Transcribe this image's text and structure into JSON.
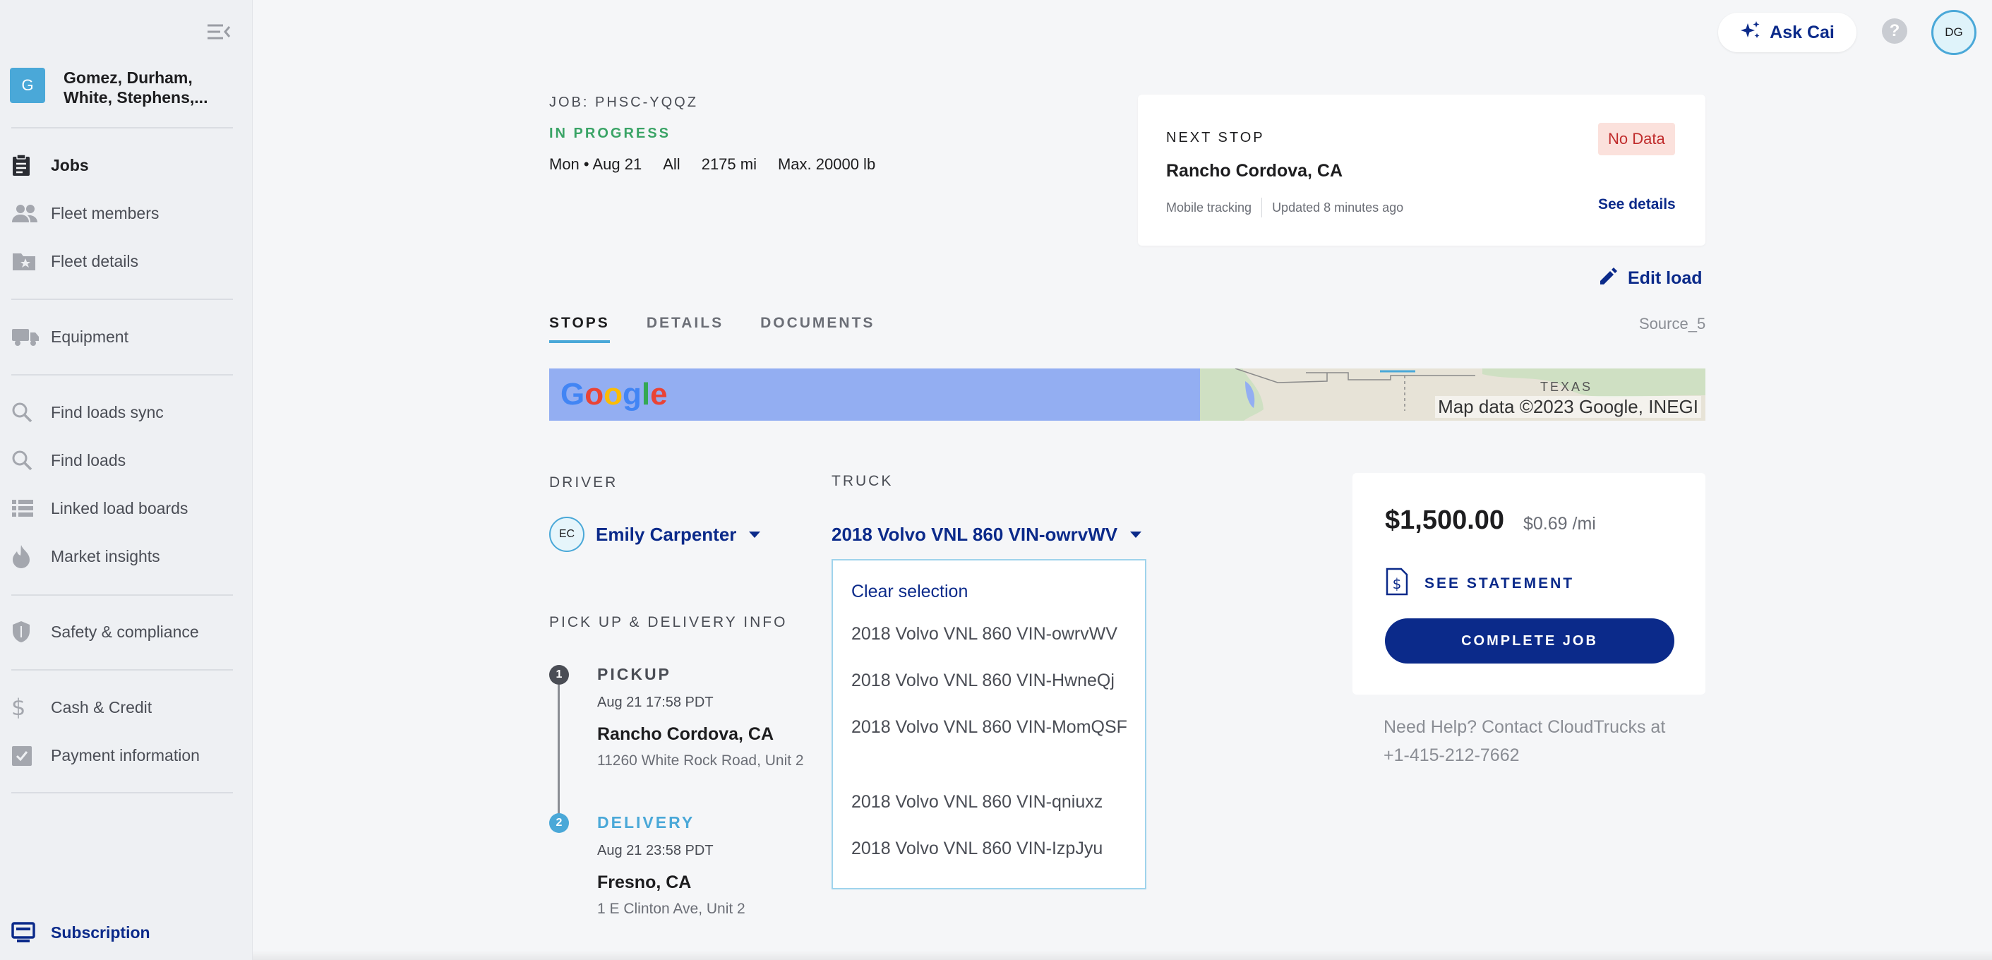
{
  "org": {
    "initial": "G",
    "name": "Gomez, Durham, White, Stephens,..."
  },
  "sidebar": {
    "items": [
      {
        "label": "Jobs",
        "icon": "clipboard-icon"
      },
      {
        "label": "Fleet members",
        "icon": "people-icon"
      },
      {
        "label": "Fleet details",
        "icon": "folder-star-icon"
      },
      {
        "label": "Equipment",
        "icon": "truck-icon"
      },
      {
        "label": "Find loads sync",
        "icon": "search-icon"
      },
      {
        "label": "Find loads",
        "icon": "search-icon"
      },
      {
        "label": "Linked load boards",
        "icon": "list-icon"
      },
      {
        "label": "Market insights",
        "icon": "flame-icon"
      },
      {
        "label": "Safety & compliance",
        "icon": "shield-icon"
      },
      {
        "label": "Cash & Credit",
        "icon": "dollar-icon"
      },
      {
        "label": "Payment information",
        "icon": "check-box-icon"
      }
    ],
    "subscription": "Subscription"
  },
  "topbar": {
    "ask_cai": "Ask Cai",
    "help": "?",
    "user_initials": "DG"
  },
  "job": {
    "id_label": "JOB: PHSC-YQQZ",
    "status": "IN PROGRESS",
    "meta": [
      "Mon • Aug 21",
      "All",
      "2175 mi",
      "Max. 20000 lb"
    ]
  },
  "next_stop": {
    "label": "NEXT STOP",
    "badge": "No Data",
    "city": "Rancho Cordova, CA",
    "tracking": "Mobile tracking",
    "updated": "Updated 8 minutes ago",
    "see_details": "See details"
  },
  "edit_load": "Edit load",
  "tabs": [
    "STOPS",
    "DETAILS",
    "DOCUMENTS"
  ],
  "source": "Source_5",
  "map": {
    "credit": "Map data ©2023 Google, INEGI",
    "region_label": "TEXAS"
  },
  "driver": {
    "label": "DRIVER",
    "initials": "EC",
    "name": "Emily Carpenter"
  },
  "truck": {
    "label": "TRUCK",
    "selected": "2018 Volvo VNL 860 VIN-owrvWV",
    "clear": "Clear selection",
    "options": [
      "2018 Volvo VNL 860 VIN-owrvWV",
      "2018 Volvo VNL 860 VIN-HwneQj",
      "2018 Volvo VNL 860 VIN-MomQSF",
      "2018 Volvo VNL 860 VIN-qniuxz",
      "2018 Volvo VNL 860 VIN-IzpJyu"
    ]
  },
  "pickup_delivery": {
    "label": "PICK UP & DELIVERY INFO",
    "stops": [
      {
        "num": "1",
        "type": "PICKUP",
        "time": "Aug 21 17:58 PDT",
        "city": "Rancho Cordova, CA",
        "address": "11260 White Rock Road, Unit 2"
      },
      {
        "num": "2",
        "type": "DELIVERY",
        "time": "Aug 21 23:58 PDT",
        "city": "Fresno, CA",
        "address": "1 E Clinton Ave, Unit 2"
      }
    ]
  },
  "payment": {
    "amount": "$1,500.00",
    "rate": "$0.69 /mi",
    "statement": "SEE STATEMENT",
    "complete": "COMPLETE JOB",
    "help": "Need Help? Contact CloudTrucks at +1-415-212-7662"
  },
  "colors": {
    "accent": "#0b2a8a",
    "brand_blue": "#4aa8d8",
    "status_green": "#3aa466",
    "alert_red": "#c02c2c"
  }
}
